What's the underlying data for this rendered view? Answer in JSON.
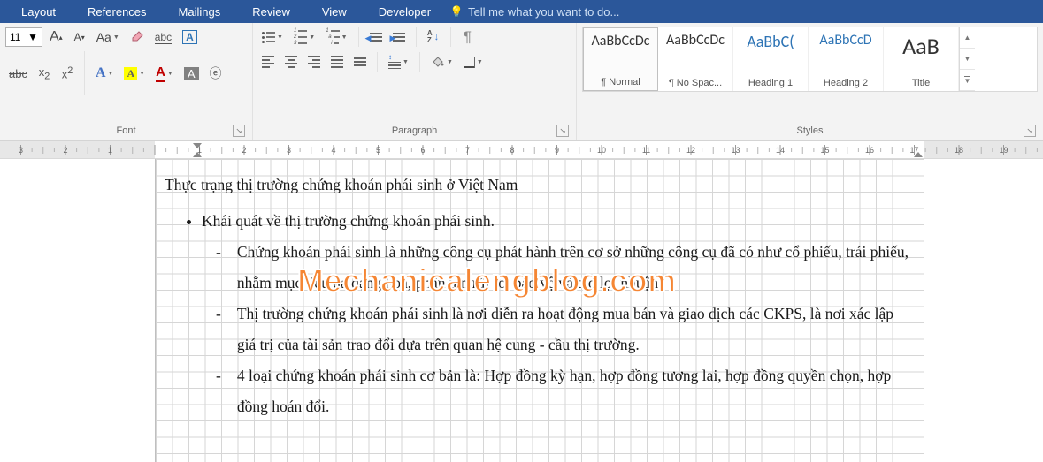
{
  "tabs": [
    "Layout",
    "References",
    "Mailings",
    "Review",
    "View",
    "Developer"
  ],
  "tellme": "Tell me what you want to do...",
  "font": {
    "groupLabel": "Font",
    "size": "11",
    "growTip": "A",
    "shrinkTip": "A",
    "caseTip": "Aa",
    "clear": "clear",
    "textEffectsA": "A",
    "highlightA": "A",
    "fontColorA": "A",
    "boxA": "A",
    "strike": "abc",
    "sub": "x₂",
    "sup": "x²",
    "shadeA": "A",
    "circledE": "ⓔ"
  },
  "paragraph": {
    "groupLabel": "Paragraph",
    "sort": "A→Z",
    "pilcrow": "¶"
  },
  "styles": {
    "groupLabel": "Styles",
    "items": [
      {
        "preview": "AaBbCcDc",
        "name": "¶ Normal",
        "cls": ""
      },
      {
        "preview": "AaBbCcDc",
        "name": "¶ No Spac...",
        "cls": ""
      },
      {
        "preview": "AaBbC(",
        "name": "Heading 1",
        "cls": "h1"
      },
      {
        "preview": "AaBbCcD",
        "name": "Heading 2",
        "cls": "h2"
      },
      {
        "preview": "AaB",
        "name": "Title",
        "cls": "title"
      }
    ]
  },
  "ruler": {
    "labels": [
      "2",
      "1",
      "1",
      "2",
      "3",
      "4",
      "5",
      "6",
      "7",
      "8",
      "9",
      "10",
      "11",
      "12",
      "13",
      "14",
      "15",
      "16",
      "17",
      "18",
      "19"
    ]
  },
  "doc": {
    "title": "Thực trạng thị trường chứng khoán phái sinh ở Việt Nam",
    "b1": "Khái quát về thị trường chứng khoán phái sinh.",
    "d1": "Chứng khoán phái sinh là những công cụ phát hành trên cơ sở những công cụ đã có như cổ phiếu, trái phiếu, nhằm mục tiêu đa dạng hoá, phân tán rủi ro, bảo vệ và tạo lợi nhuận.",
    "d2": "Thị trường chứng khoán phái sinh là nơi diễn ra hoạt động mua bán và giao dịch các CKPS, là nơi xác lập giá trị của tài sản trao đổi dựa trên quan hệ cung - cầu thị trường.",
    "d3": "4 loại chứng khoán phái sinh cơ bản là: Hợp đồng kỳ hạn, hợp đồng tương lai, hợp đồng quyền chọn, hợp đồng hoán đổi."
  },
  "watermark": "Mechanicalengblog.com"
}
